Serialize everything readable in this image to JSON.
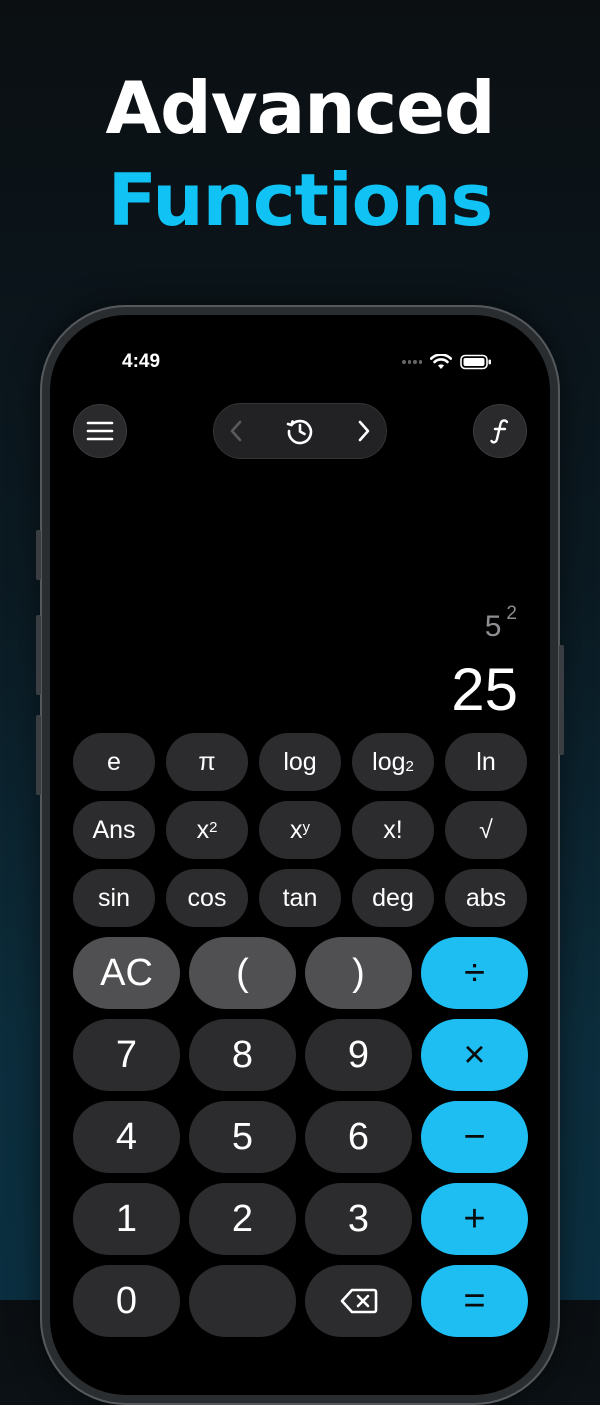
{
  "headline": {
    "line1": "Advanced",
    "line2": "Functions"
  },
  "status_bar": {
    "time": "4:49"
  },
  "toolbar": {
    "menu_icon": "hamburger-icon",
    "history_icon": "clock-history-icon",
    "functions_icon": "function-f-icon"
  },
  "display": {
    "expression_base": "5",
    "expression_exponent": "2",
    "result": "25"
  },
  "scientific_keys": {
    "row1": [
      "e",
      "π",
      "log",
      "log",
      "ln"
    ],
    "log2_sub": "2",
    "row2": {
      "ans": "Ans",
      "x2_base": "x",
      "x2_exp": "2",
      "xy_base": "x",
      "xy_exp": "y",
      "fact": "x!",
      "sqrt": "√"
    },
    "row3": [
      "sin",
      "cos",
      "tan",
      "deg",
      "abs"
    ]
  },
  "keypad": {
    "clear": "AC",
    "paren_open": "(",
    "paren_close": ")",
    "divide": "÷",
    "multiply": "×",
    "minus": "−",
    "plus": "+",
    "equals": "=",
    "digits": [
      "7",
      "8",
      "9",
      "4",
      "5",
      "6",
      "1",
      "2",
      "3",
      "0"
    ]
  },
  "colors": {
    "accent": "#11c2f4",
    "operator_key": "#1fbef2",
    "key_dark": "#2c2c2e",
    "key_gray": "#505052"
  }
}
